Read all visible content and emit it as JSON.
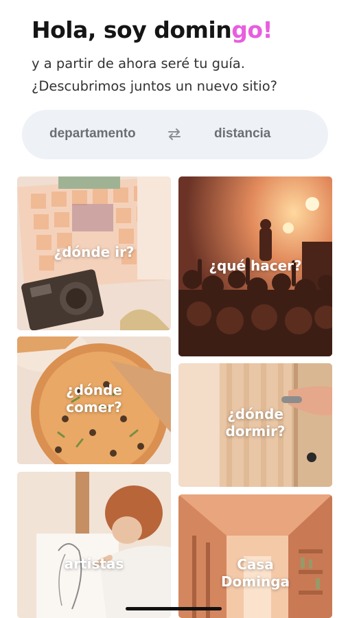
{
  "header": {
    "title_prefix": "Hola, soy domin",
    "title_accent": "go!",
    "subtitle": "y a partir de ahora seré tu guía. ¿Descubrimos juntos un nuevo sitio?"
  },
  "toggle": {
    "option_left": "departamento",
    "option_right": "distancia",
    "swap_icon": "swap-arrows-icon"
  },
  "cards": [
    {
      "label": "¿dónde ir?",
      "image": "city-map-with-camera"
    },
    {
      "label": "¿qué hacer?",
      "image": "concert-crowd"
    },
    {
      "label": "¿dónde comer?",
      "image": "pizza"
    },
    {
      "label": "¿dónde dormir?",
      "image": "door-handle"
    },
    {
      "label": "artistas",
      "image": "woman-painting"
    },
    {
      "label": "Casa Dominga",
      "image": "house-corridor"
    }
  ],
  "colors": {
    "accent": "#e95de0",
    "toggle_bg": "#eef1f5",
    "card_tint": "#e7a27a"
  }
}
